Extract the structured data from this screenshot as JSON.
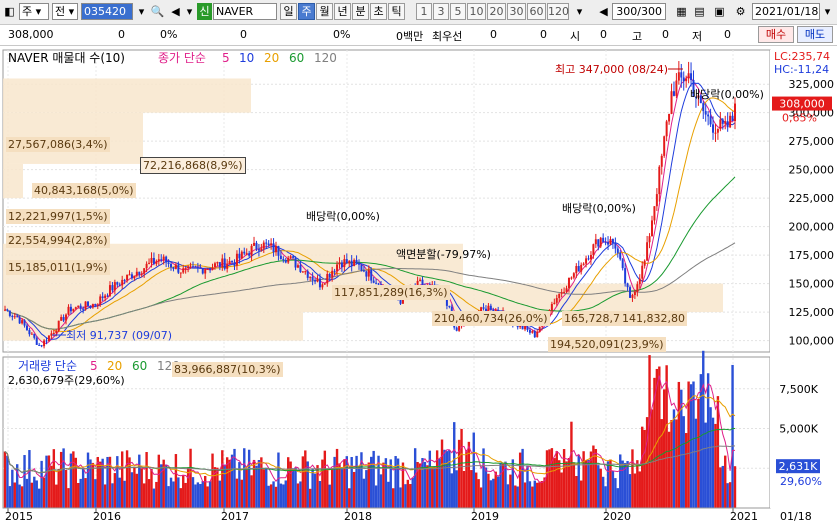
{
  "toolbar": {
    "type_label": "주",
    "prev_label": "전",
    "code": "035420",
    "new_badge": "신",
    "name": "NAVER",
    "periods": [
      "일",
      "주",
      "월",
      "년",
      "분",
      "초",
      "틱"
    ],
    "active_period": "주",
    "intervals": [
      "1",
      "3",
      "5",
      "10",
      "20",
      "30",
      "60",
      "120"
    ],
    "count": "300/300",
    "date": "2021/01/18"
  },
  "statusbar": {
    "price": "308,000",
    "v1": "0",
    "p1": "0%",
    "v2": "0",
    "p2": "0%",
    "vol_label": "0백만",
    "best_label": "최우선",
    "b1": "0",
    "b2": "0",
    "o_label": "시",
    "o_val": "0",
    "h_label": "고",
    "h_val": "0",
    "l_label": "저",
    "l_val": "0",
    "buy": "매수",
    "sell": "매도"
  },
  "price_panel": {
    "title": "NAVER 매물대 수(10)",
    "ma_title": "종가 단순",
    "ma_periods": [
      "5",
      "10",
      "20",
      "60",
      "120"
    ],
    "ma_colors": [
      "#e0208a",
      "#1e3cdc",
      "#e8a000",
      "#1a9a30",
      "#808080"
    ],
    "lc": "LC:235,74",
    "hc": "HC:-11,24",
    "current_price": "308,000",
    "current_pct": "0,65%",
    "y_ticks": [
      "325,000",
      "300,000",
      "275,000",
      "250,000",
      "225,000",
      "200,000",
      "175,000",
      "150,000",
      "125,000",
      "100,000"
    ],
    "high_label": "최고 347,000 (08/24)",
    "low_label": "최저 91,737 (09/07)",
    "dividend_labels": [
      "배당락(0,00%)",
      "배당락(0,00%)",
      "배당락(0,00%)"
    ],
    "split_label": "액면분할(-79,97%)",
    "profile_labels": [
      "27,567,086(3,4%)",
      "72,216,868(8,9%)",
      "40,843,168(5,0%)",
      "12,221,997(1,5%)",
      "22,554,994(2,8%)",
      "15,185,011(1,9%)",
      "117,851,289(16,3%)",
      "210,460,734(26,0%)",
      "165,728,7",
      "141,832,80",
      "194,520,091(23,9%)",
      "83,966,887(10,3%)"
    ]
  },
  "volume_panel": {
    "title": "거래량 단순",
    "ma_periods": [
      "5",
      "20",
      "60",
      "120"
    ],
    "ma_colors": [
      "#e0208a",
      "#e8a000",
      "#1a9a30",
      "#808080"
    ],
    "last": "2,630,679주(29,60%)",
    "y_ticks": [
      "7,500K",
      "5,000K",
      "2,500K"
    ],
    "current_vol": "2,631K",
    "current_pct": "29,60%"
  },
  "x_axis": [
    "2015",
    "2016",
    "2017",
    "2018",
    "2019",
    "2020",
    "2021"
  ],
  "x_end": "01/18",
  "chart_data": {
    "type": "line",
    "title": "NAVER",
    "x": [
      "2015",
      "2016",
      "2017",
      "2018",
      "2019",
      "2020",
      "2021"
    ],
    "series": [
      {
        "name": "종가",
        "values": [
          130000,
          105000,
          160000,
          150000,
          130000,
          150000,
          308000
        ]
      }
    ],
    "ylim": [
      90000,
      350000
    ],
    "annotations": {
      "high": {
        "value": 347000,
        "date": "08/24"
      },
      "low": {
        "value": 91737,
        "date": "09/07"
      }
    },
    "volume_profile": [
      {
        "volume": 27567086,
        "pct": 3.4
      },
      {
        "volume": 72216868,
        "pct": 8.9
      },
      {
        "volume": 40843168,
        "pct": 5.0
      },
      {
        "volume": 12221997,
        "pct": 1.5
      },
      {
        "volume": 22554994,
        "pct": 2.8
      },
      {
        "volume": 15185011,
        "pct": 1.9
      },
      {
        "volume": 117851289,
        "pct": 16.3
      },
      {
        "volume": 210460734,
        "pct": 26.0
      },
      {
        "volume": 194520091,
        "pct": 23.9
      },
      {
        "volume": 83966887,
        "pct": 10.3
      }
    ]
  }
}
